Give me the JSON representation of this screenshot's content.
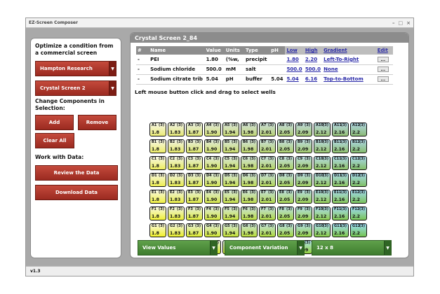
{
  "window": {
    "title": "EZ-Screen Composer",
    "minimize": "–",
    "maximize": "□",
    "close": "×"
  },
  "left_panel": {
    "optimize_heading": "Optimize a condition from a commercial screen",
    "vendor_value": "Hampton Research",
    "screen_value": "Crystal Screen 2",
    "change_heading": "Change Components in Selection:",
    "add_label": "Add",
    "remove_label": "Remove",
    "clear_label": "Clear All",
    "work_heading": "Work with Data:",
    "review_label": "Review the Data",
    "download_label": "Download Data",
    "dropdown_arrow": "▼"
  },
  "main": {
    "title": "Crystal Screen 2_84",
    "hint": "Left mouse button click and drag to select wells"
  },
  "table": {
    "headers": [
      "#",
      "Name",
      "Value",
      "Units",
      "Type",
      "pH",
      "Low",
      "High",
      "Gradient",
      "Edit"
    ],
    "rows": [
      {
        "num": "-",
        "name": "PEI",
        "value": "1.80",
        "units": "(%w,",
        "type": "precipit",
        "ph": "",
        "low": "1.80",
        "high": "2.20",
        "gradient": "Left-To-Right",
        "edit": "..."
      },
      {
        "num": "-",
        "name": "Sodium chloride",
        "value": "500.0",
        "units": "mM",
        "type": "salt",
        "ph": "",
        "low": "500.0",
        "high": "500.0",
        "gradient": "None",
        "edit": "..."
      },
      {
        "num": "-",
        "name": "Sodium citrate trib",
        "value": "5.04",
        "units": "pH",
        "type": "buffer",
        "ph": "5.04",
        "low": "5.04",
        "high": "6.16",
        "gradient": "Top-to-Bottom",
        "edit": "..."
      }
    ]
  },
  "plate": {
    "rows": [
      "A",
      "B",
      "C",
      "D",
      "E",
      "F",
      "G",
      "H"
    ],
    "columns": [
      "1",
      "2",
      "3",
      "4",
      "5",
      "6",
      "7",
      "8",
      "9",
      "10",
      "11",
      "12"
    ],
    "values": [
      "1.8",
      "1.83",
      "1.87",
      "1.90",
      "1.94",
      "1.98",
      "2.01",
      "2.05",
      "2.09",
      "2.12",
      "2.16",
      "2.2"
    ],
    "count": "(3)",
    "column_colors_top": [
      "#f8f8e0",
      "#f0f4dc",
      "#e6f0d8",
      "#dcecd6",
      "#d2e8d6",
      "#c8e4d8",
      "#bfe2dc",
      "#b6e0e2",
      "#aedfe8",
      "#a6deee",
      "#9edcf3",
      "#97dbf7"
    ],
    "column_colors_bottom": [
      "#f2f21e",
      "#e8ee22",
      "#dceb26",
      "#d0e72a",
      "#c4e32e",
      "#b8df32",
      "#acdb36",
      "#a0d73a",
      "#94d33e",
      "#88cf42",
      "#7ccb46",
      "#70c74a"
    ]
  },
  "bottom": {
    "view_value": "View Values",
    "variation_value": "Component Variation",
    "format_value": "12 x 8",
    "dropdown_arrow": "▼"
  },
  "status": {
    "version": "v1.3"
  }
}
